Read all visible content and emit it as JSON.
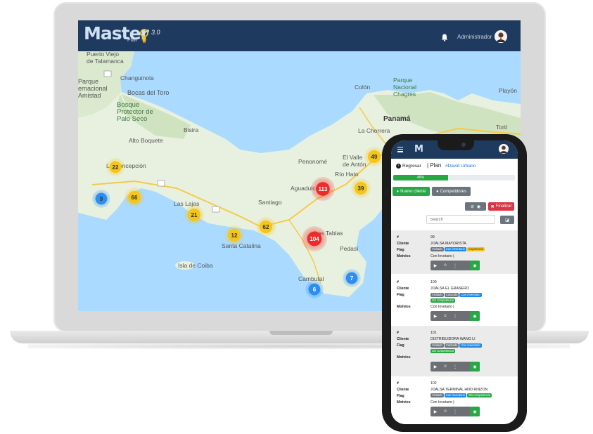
{
  "app": {
    "logo": "Master",
    "logo_sub": "Plan",
    "version": "3.0",
    "user": "Administrador"
  },
  "map": {
    "labels": [
      {
        "text": "Puerto Viejo\nde Talamanca"
      },
      {
        "text": "Parque\nernacional\nAmistad"
      },
      {
        "text": "Changuinola"
      },
      {
        "text": "Bocas del Toro"
      },
      {
        "text": "Bosque\nProtector de\nPalo Seco"
      },
      {
        "text": "Colón"
      },
      {
        "text": "Parque\nNacional\nChagres"
      },
      {
        "text": "Playón"
      },
      {
        "text": "Panamá"
      },
      {
        "text": "La Chorrera"
      },
      {
        "text": "Tortí"
      },
      {
        "text": "Bisira"
      },
      {
        "text": "Alto Boquete"
      },
      {
        "text": "La Concepción"
      },
      {
        "text": "El Valle\nde Antón"
      },
      {
        "text": "Río Hato"
      },
      {
        "text": "Penonomé"
      },
      {
        "text": "Aguadulce"
      },
      {
        "text": "Las Lajas"
      },
      {
        "text": "Santiago"
      },
      {
        "text": "Las Tablas"
      },
      {
        "text": "Santa Catalina"
      },
      {
        "text": "Isla de Coiba"
      },
      {
        "text": "Pedasí"
      },
      {
        "text": "Cambutal"
      }
    ],
    "clusters": [
      {
        "count": "22",
        "color": "#f5c518"
      },
      {
        "count": "9",
        "color": "#2d8ef2"
      },
      {
        "count": "66",
        "color": "#f5c518"
      },
      {
        "count": "21",
        "color": "#f5c518"
      },
      {
        "count": "12",
        "color": "#f5c518"
      },
      {
        "count": "62",
        "color": "#f5c518"
      },
      {
        "count": "113",
        "color": "#ee2a2a"
      },
      {
        "count": "39",
        "color": "#f5c518"
      },
      {
        "count": "49",
        "color": "#f5c518"
      },
      {
        "count": "104",
        "color": "#ee2a2a"
      },
      {
        "count": "6",
        "color": "#2d8ef2"
      },
      {
        "count": "7",
        "color": "#2d8ef2"
      }
    ]
  },
  "phone": {
    "back": "Regresar",
    "plan_label": "Plan",
    "plan_user": "#David Urbano",
    "progress": "45%",
    "progress_value": 45,
    "new_client": "Nuevo cliente",
    "competitors": "Competidores",
    "finish": "Finalizar",
    "search_placeholder": "Search",
    "field_labels": {
      "num": "#",
      "client": "Cliente",
      "flag": "Flag",
      "motives": "Motvios"
    },
    "records": [
      {
        "num": "99",
        "client": "JOALSA MAYORISTA",
        "flags": [
          {
            "text": "Visitado",
            "color": "#6c757d"
          },
          {
            "text": "Con inventario",
            "color": "#1e88e5"
          },
          {
            "text": "Copetencia",
            "color": "#f5c518"
          }
        ],
        "motives": "Con Invetario |"
      },
      {
        "num": "100",
        "client": "JOALSA EL GRANERO",
        "flags": [
          {
            "text": "Visitado",
            "color": "#6c757d"
          },
          {
            "text": "Cotizado",
            "color": "#6c757d"
          },
          {
            "text": "Con Inventario",
            "color": "#1e88e5"
          },
          {
            "text": "Sin competencia",
            "color": "#28a745"
          }
        ],
        "motives": "Con Invetario |"
      },
      {
        "num": "101",
        "client": "DISTRIBUIDORA WANG LI",
        "flags": [
          {
            "text": "Visitado",
            "color": "#6c757d"
          },
          {
            "text": "Cotizado",
            "color": "#6c757d"
          },
          {
            "text": "Con Inventario",
            "color": "#1e88e5"
          },
          {
            "text": "Sin competencia",
            "color": "#28a745"
          }
        ],
        "motives": ""
      },
      {
        "num": "102",
        "client": "JOALSA TERMINAL HNO RINZON",
        "flags": [
          {
            "text": "Visitado",
            "color": "#6c757d"
          },
          {
            "text": "Con Inventario",
            "color": "#1e88e5"
          },
          {
            "text": "Sin competencia",
            "color": "#28a745"
          }
        ],
        "motives": "Con Invetario |"
      }
    ]
  },
  "colors": {
    "header": "#1f3a5f",
    "primary_green": "#28a745",
    "danger": "#dc3545",
    "secondary": "#6c757d",
    "water": "#aadaff",
    "land": "#e8f1e0"
  }
}
